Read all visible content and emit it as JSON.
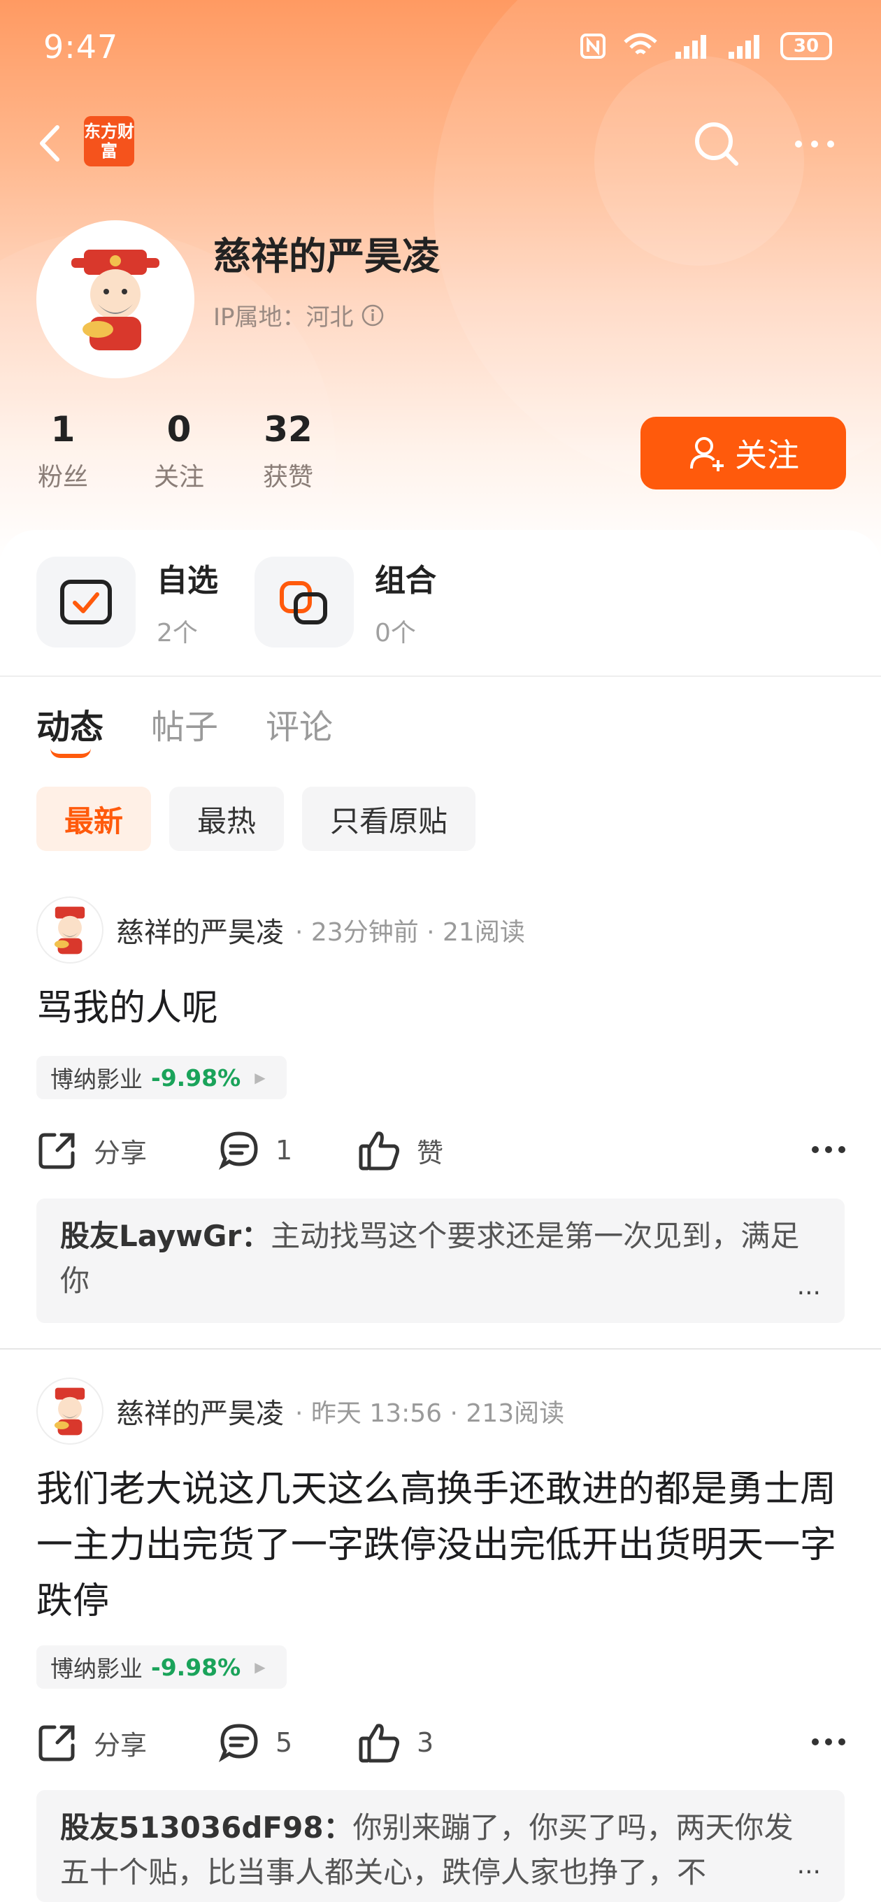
{
  "status_bar": {
    "time": "9:47",
    "battery": "30"
  },
  "navbar": {
    "app_logo_text": "东方财富"
  },
  "profile": {
    "name": "慈祥的严昊凌",
    "ip_location": "IP属地：河北",
    "stats": [
      {
        "value": "1",
        "label": "粉丝"
      },
      {
        "value": "0",
        "label": "关注"
      },
      {
        "value": "32",
        "label": "获赞"
      }
    ],
    "follow_label": "关注"
  },
  "shortcuts": [
    {
      "title": "自选",
      "count": "2个"
    },
    {
      "title": "组合",
      "count": "0个"
    }
  ],
  "tabs": [
    {
      "label": "动态",
      "active": true
    },
    {
      "label": "帖子",
      "active": false
    },
    {
      "label": "评论",
      "active": false
    }
  ],
  "filters": [
    {
      "label": "最新",
      "active": true
    },
    {
      "label": "最热",
      "active": false
    },
    {
      "label": "只看原贴",
      "active": false
    }
  ],
  "posts": [
    {
      "author": "慈祥的严昊凌",
      "meta": "· 23分钟前 · 21阅读",
      "text": "骂我的人呢",
      "stock_name": "博纳影业",
      "stock_change": "-9.98%",
      "share_label": "分享",
      "comment_count": "1",
      "like_label": "赞",
      "comment": {
        "user": "股友LaywGr：",
        "text": "主动找骂这个要求还是第一次见到，满足你"
      }
    },
    {
      "author": "慈祥的严昊凌",
      "meta": "· 昨天 13:56 · 213阅读",
      "text": "我们老大说这几天这么高换手还敢进的都是勇士周一主力出完货了一字跌停没出完低开出货明天一字跌停",
      "stock_name": "博纳影业",
      "stock_change": "-9.98%",
      "share_label": "分享",
      "comment_count": "5",
      "like_label": "3",
      "comment": {
        "user": "股友513036dF98：",
        "text": "你别来蹦了，你买了吗，两天你发五十个贴，比当事人都关心，跌停人家也挣了，不"
      }
    }
  ],
  "colors": {
    "accent": "#ff5a0c",
    "stock_down": "#1aa35a",
    "header_top": "#ff9a62"
  },
  "icons": [
    "back-icon",
    "search-icon",
    "more-icon",
    "info-icon",
    "add-user-icon",
    "check-icon",
    "portfolio-icon",
    "share-icon",
    "comment-icon",
    "like-icon"
  ]
}
